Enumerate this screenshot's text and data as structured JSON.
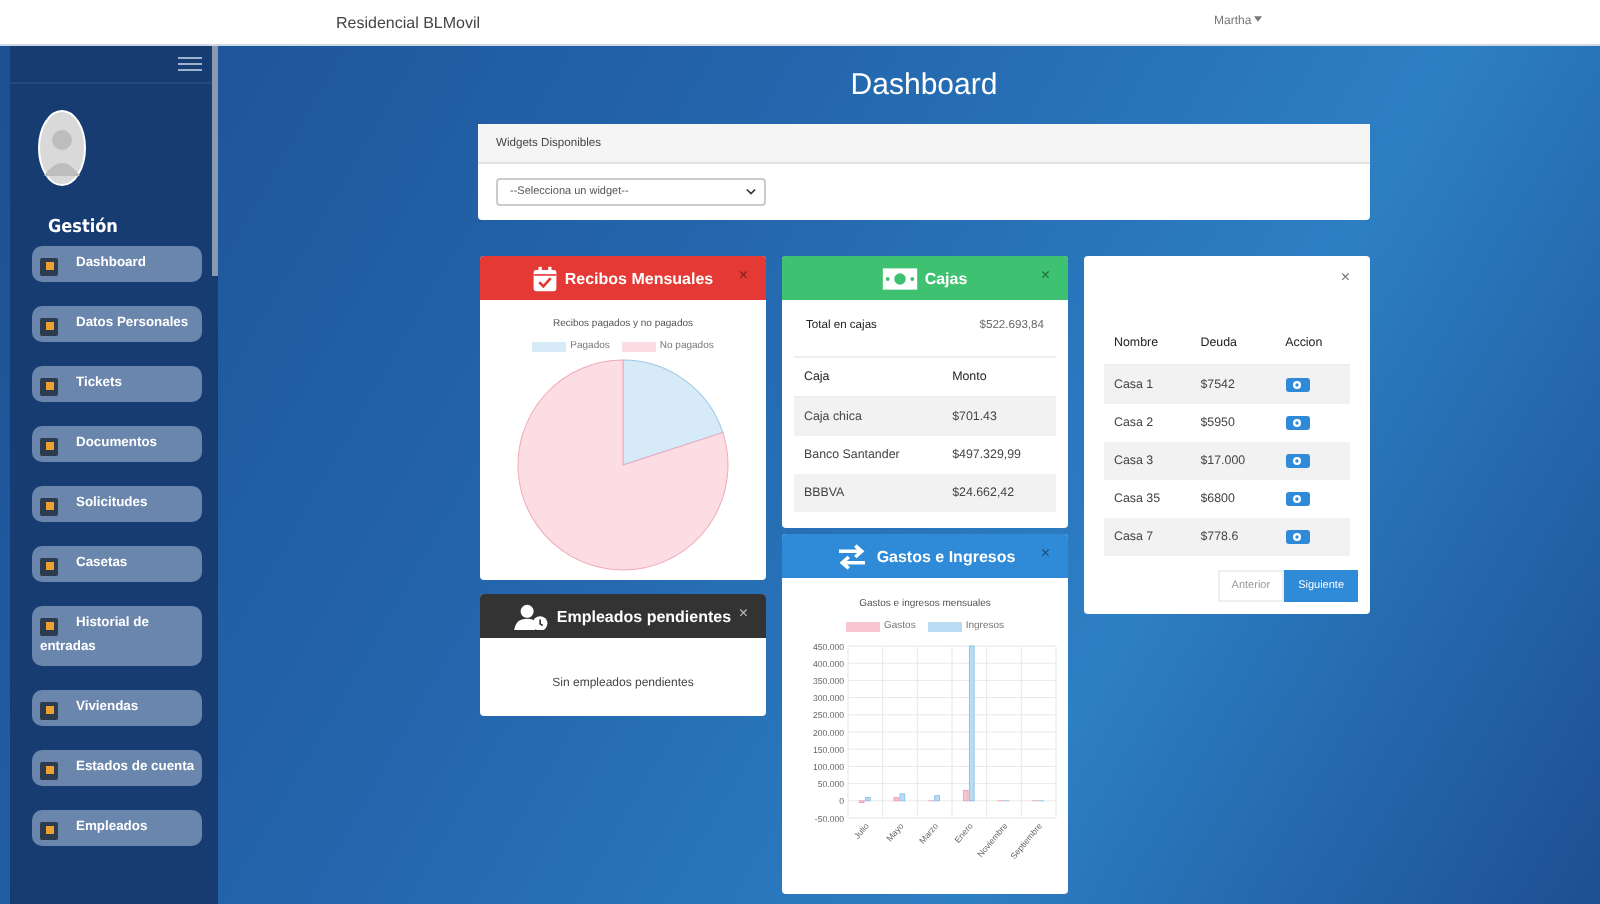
{
  "navbar": {
    "brand": "Residencial BLMovil",
    "user": "Martha"
  },
  "sidebar": {
    "section": "Gestión",
    "items": [
      {
        "label": "Dashboard"
      },
      {
        "label": "Datos Personales"
      },
      {
        "label": "Tickets"
      },
      {
        "label": "Documentos"
      },
      {
        "label": "Solicitudes"
      },
      {
        "label": "Casetas"
      },
      {
        "label": "Historial de entradas"
      },
      {
        "label": "Viviendas"
      },
      {
        "label": "Estados de cuenta"
      },
      {
        "label": "Empleados"
      }
    ]
  },
  "page_title": "Dashboard",
  "widgets_panel": {
    "title": "Widgets Disponibles",
    "select_value": "--Selecciona un widget--"
  },
  "recibos": {
    "title": "Recibos Mensuales",
    "close": "×",
    "chart_title": "Recibos pagados y no pagados",
    "legend": [
      {
        "label": "Pagados",
        "color": "#d6eaf8"
      },
      {
        "label": "No pagados",
        "color": "#fbdde3"
      }
    ]
  },
  "empleados": {
    "title": "Empleados pendientes",
    "close": "×",
    "message": "Sin empleados pendientes"
  },
  "cajas": {
    "title": "Cajas",
    "close": "×",
    "total_label": "Total en cajas",
    "total_value": "$522.693,84",
    "columns": [
      "Caja",
      "Monto"
    ],
    "rows": [
      [
        "Caja chica",
        "$701.43"
      ],
      [
        "Banco Santander",
        "$497.329,99"
      ],
      [
        "BBBVA",
        "$24.662,42"
      ]
    ]
  },
  "gastos": {
    "title": "Gastos e Ingresos",
    "close": "×",
    "chart_data": {
      "type": "bar",
      "grid": true,
      "title": "Gastos e ingresos mensuales",
      "categories": [
        "Julio",
        "Mayo",
        "Marzo",
        "Enero",
        "Noviembre",
        "Septiembre"
      ],
      "series": [
        {
          "name": "Gastos",
          "color": "#f7c6d0",
          "values": [
            -5000,
            10000,
            0,
            30000,
            0,
            0
          ]
        },
        {
          "name": "Ingresos",
          "color": "#b9dcf2",
          "values": [
            10000,
            20000,
            15000,
            450000,
            0,
            0
          ]
        }
      ],
      "ylim": [
        -50000,
        450000
      ],
      "yticks": [
        {
          "value": 450000,
          "label": "450.000"
        },
        {
          "value": 400000,
          "label": "400.000"
        },
        {
          "value": 350000,
          "label": "350.000"
        },
        {
          "value": 300000,
          "label": "300.000"
        },
        {
          "value": 250000,
          "label": "250.000"
        },
        {
          "value": 200000,
          "label": "200.000"
        },
        {
          "value": 150000,
          "label": "150.000"
        },
        {
          "value": 100000,
          "label": "100.000"
        },
        {
          "value": 50000,
          "label": "50.000"
        },
        {
          "value": 0,
          "label": "0"
        },
        {
          "value": -50000,
          "label": "-50.000"
        }
      ]
    }
  },
  "deudas": {
    "close": "×",
    "columns": [
      "Nombre",
      "Deuda",
      "Accion"
    ],
    "rows": [
      [
        "Casa 1",
        "$7542"
      ],
      [
        "Casa 2",
        "$5950"
      ],
      [
        "Casa 3",
        "$17.000"
      ],
      [
        "Casa 35",
        "$6800"
      ],
      [
        "Casa 7",
        "$778.6"
      ]
    ],
    "pagination": [
      {
        "label": "Anterior",
        "disabled": true
      },
      {
        "label": "Siguiente",
        "disabled": false
      }
    ]
  }
}
